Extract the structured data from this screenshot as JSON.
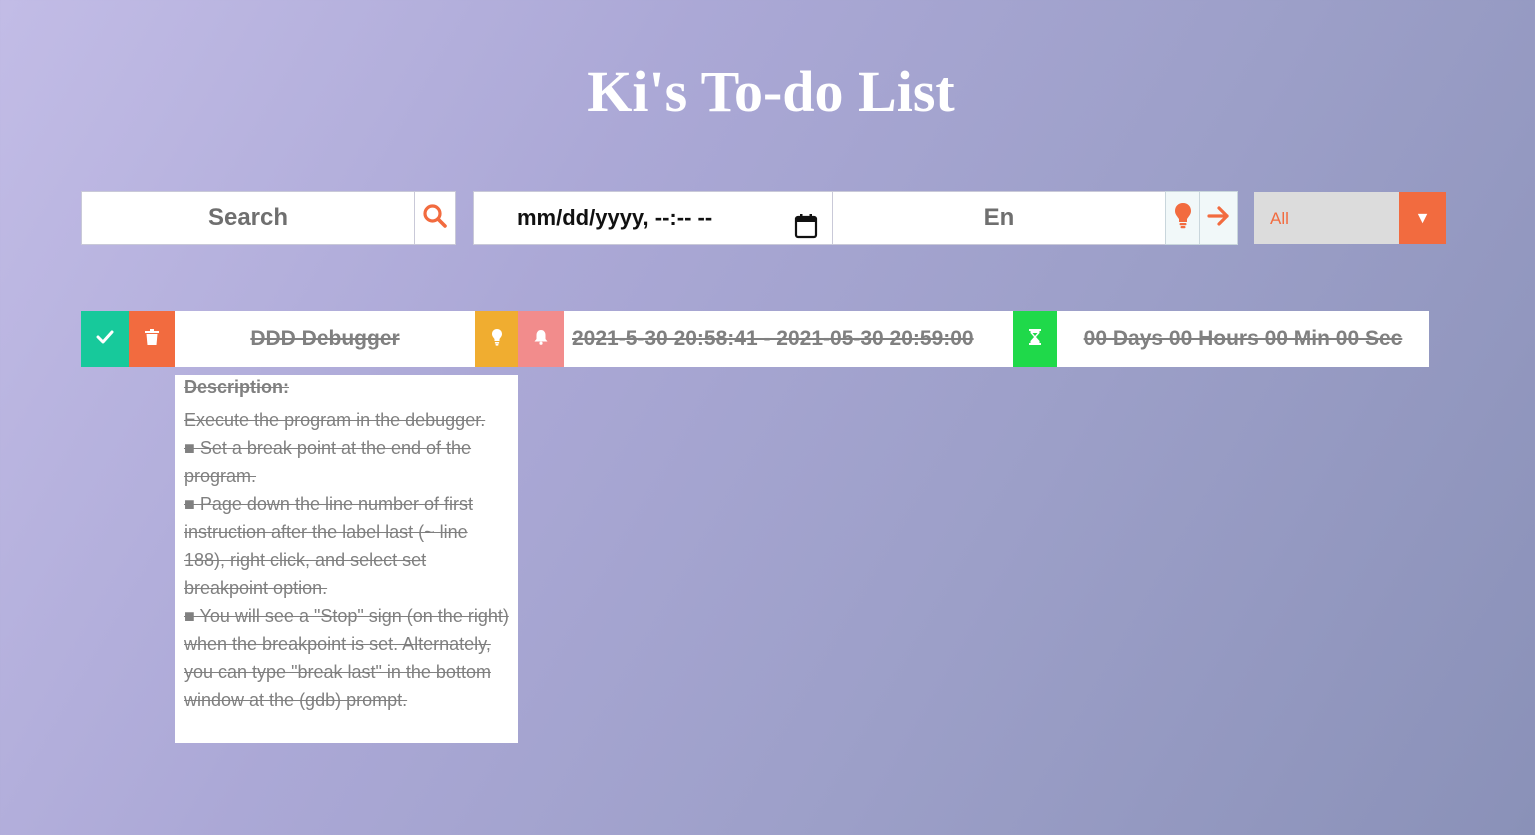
{
  "header": {
    "title": "Ki's To-do List"
  },
  "toolbar": {
    "search_placeholder": "Search",
    "date_placeholder": "mm/dd/yyyy, --:-- --",
    "task_placeholder": "En",
    "filter_selected": "All",
    "filter_arrow": "▼"
  },
  "task": {
    "name": "DDD Debugger",
    "dates": "2021-5-30 20:58:41 - 2021-05-30 20:59:00",
    "countdown": "00 Days 00 Hours 00 Min 00 Sec",
    "completed": true,
    "description_title": "Description:",
    "description_lines": [
      "Execute the program in the debugger.",
      "■ Set a break point at the end of the program.",
      "■ Page down the line number of first instruction after the label last (~ line 188), right click, and select set breakpoint option.",
      "■ You will see a \"Stop\" sign (on the right) when the breakpoint is set. Alternately, you can type \"break last\" in the bottom window at the (gdb) prompt."
    ]
  },
  "colors": {
    "accent": "#f26b3f",
    "check": "#17c99b",
    "idea": "#f0ad30",
    "bell": "#f28c8c",
    "timer": "#1fd94a"
  },
  "icons": [
    "search-icon",
    "calendar-icon",
    "lightbulb-icon",
    "arrow-right-icon",
    "check-icon",
    "trash-icon",
    "bell-icon",
    "hourglass-icon"
  ]
}
